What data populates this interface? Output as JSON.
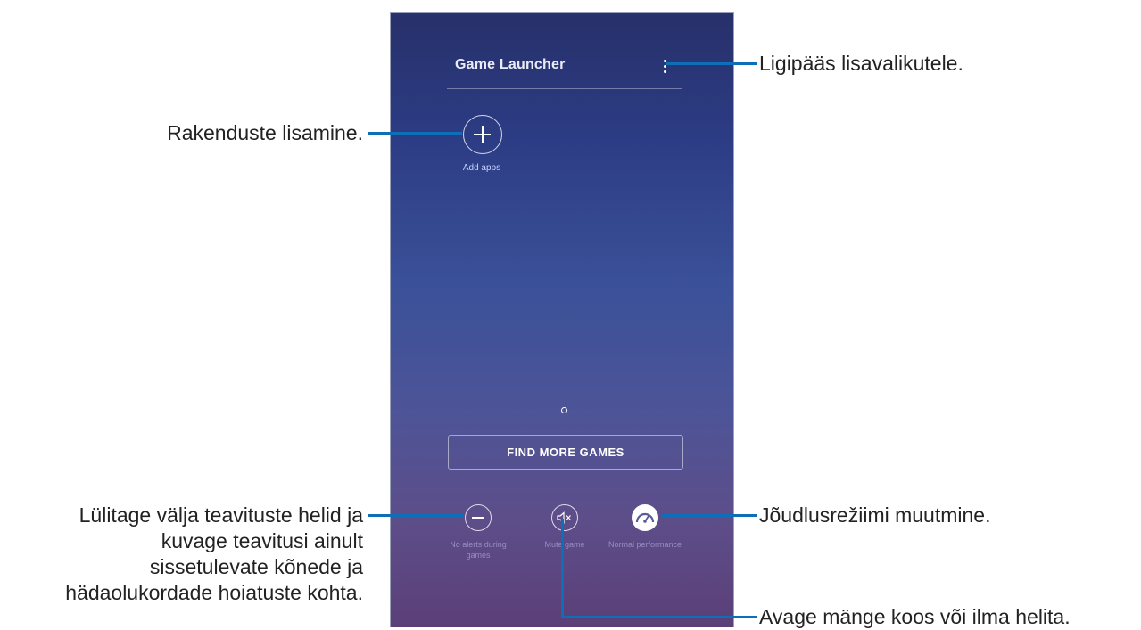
{
  "app": {
    "title": "Game Launcher",
    "add_apps_label": "Add apps",
    "find_more_games": "FIND MORE GAMES",
    "options": [
      {
        "label": "No alerts during games",
        "icon": "minus-circle-icon"
      },
      {
        "label": "Mute game",
        "icon": "speaker-mute-icon"
      },
      {
        "label": "Normal performance",
        "icon": "speedometer-icon"
      }
    ],
    "more_icon": "more-vertical-icon"
  },
  "callouts": {
    "more_options": "Ligipääs lisavalikutele.",
    "add_apps": "Rakenduste lisamine.",
    "alerts_lines": [
      "Lülitage välja teavituste helid ja",
      "kuvage teavitusi ainult",
      "sissetulevate kõnede ja",
      "hädaolukordade hoiatuste kohta."
    ],
    "performance": "Jõudlusrežiimi muutmine.",
    "mute": "Avage mänge koos või ilma helita."
  },
  "colors": {
    "callout_line": "#0d6fb8",
    "phone_top": "#27306a",
    "phone_bottom": "#5b3f78"
  }
}
